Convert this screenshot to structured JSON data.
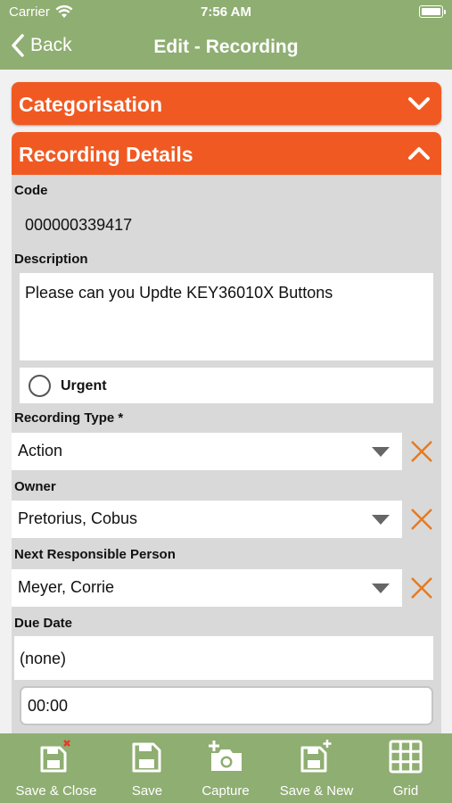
{
  "status_bar": {
    "carrier": "Carrier",
    "time": "7:56 AM"
  },
  "nav": {
    "back_label": "Back",
    "title": "Edit - Recording"
  },
  "sections": {
    "categorisation": "Categorisation",
    "recording_details": "Recording Details"
  },
  "form": {
    "code": {
      "label": "Code",
      "value": "000000339417"
    },
    "description": {
      "label": "Description",
      "value": "Please can you Updte KEY36010X Buttons"
    },
    "urgent": {
      "label": "Urgent",
      "checked": false
    },
    "recording_type": {
      "label": "Recording Type *",
      "value": "Action"
    },
    "owner": {
      "label": "Owner",
      "value": "Pretorius, Cobus"
    },
    "next_responsible": {
      "label": "Next Responsible Person",
      "value": "Meyer, Corrie"
    },
    "due_date": {
      "label": "Due Date",
      "date_value": "(none)",
      "time_value": "00:00"
    }
  },
  "toolbar": {
    "save_close": "Save & Close",
    "save": "Save",
    "capture": "Capture",
    "save_new": "Save & New",
    "grid": "Grid"
  },
  "colors": {
    "brand_green": "#8fae72",
    "section_orange": "#f05a22",
    "clear_orange": "#e8791f",
    "delete_red": "#e53b2b"
  }
}
